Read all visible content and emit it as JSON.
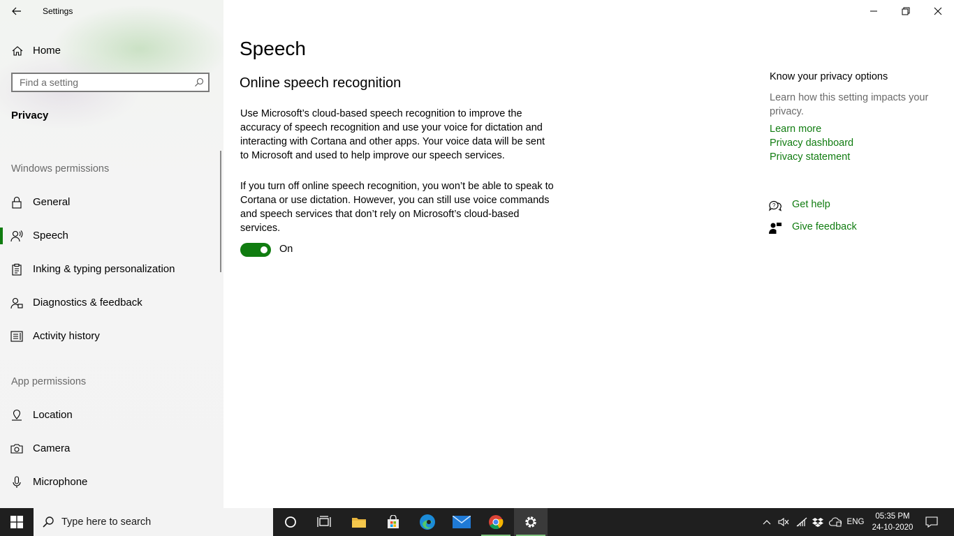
{
  "window": {
    "title": "Settings"
  },
  "sidebar": {
    "home_label": "Home",
    "search_placeholder": "Find a setting",
    "category": "Privacy",
    "windows_permissions_header": "Windows permissions",
    "windows_permissions": [
      {
        "label": "General",
        "icon": "lock-icon",
        "selected": false
      },
      {
        "label": "Speech",
        "icon": "speech-icon",
        "selected": true
      },
      {
        "label": "Inking & typing personalization",
        "icon": "clipboard-icon",
        "selected": false
      },
      {
        "label": "Diagnostics & feedback",
        "icon": "diagnostics-icon",
        "selected": false
      },
      {
        "label": "Activity history",
        "icon": "activity-history-icon",
        "selected": false
      }
    ],
    "app_permissions_header": "App permissions",
    "app_permissions": [
      {
        "label": "Location",
        "icon": "location-icon"
      },
      {
        "label": "Camera",
        "icon": "camera-icon"
      },
      {
        "label": "Microphone",
        "icon": "microphone-icon"
      }
    ]
  },
  "main": {
    "title": "Speech",
    "section_title": "Online speech recognition",
    "paragraph_1": "Use Microsoft’s cloud-based speech recognition to improve the accuracy of speech recognition and use your voice for dictation and interacting with Cortana and other apps. Your voice data will be sent to Microsoft and used to help improve our speech services.",
    "paragraph_2": "If you turn off online speech recognition, you won’t be able to speak to Cortana or use dictation. However, you can still use voice commands and speech services that don’t rely on Microsoft’s cloud-based services.",
    "toggle": {
      "state": "on",
      "label": "On"
    }
  },
  "right_panel": {
    "heading": "Know your privacy options",
    "description": "Learn how this setting impacts your privacy.",
    "links": [
      "Learn more",
      "Privacy dashboard",
      "Privacy statement"
    ],
    "get_help": "Get help",
    "give_feedback": "Give feedback"
  },
  "taskbar": {
    "search_placeholder": "Type here to search",
    "apps": [
      "cortana",
      "task-view",
      "file-explorer",
      "microsoft-store",
      "edge",
      "mail",
      "chrome",
      "settings"
    ],
    "active_app": "settings",
    "language": "ENG",
    "time": "05:35 PM",
    "date": "24-10-2020"
  },
  "colors": {
    "accent": "#107c10",
    "taskbar": "#1f1f1f",
    "sidebar_bg": "#f3f3f3",
    "muted_text": "#6a6a6a"
  }
}
